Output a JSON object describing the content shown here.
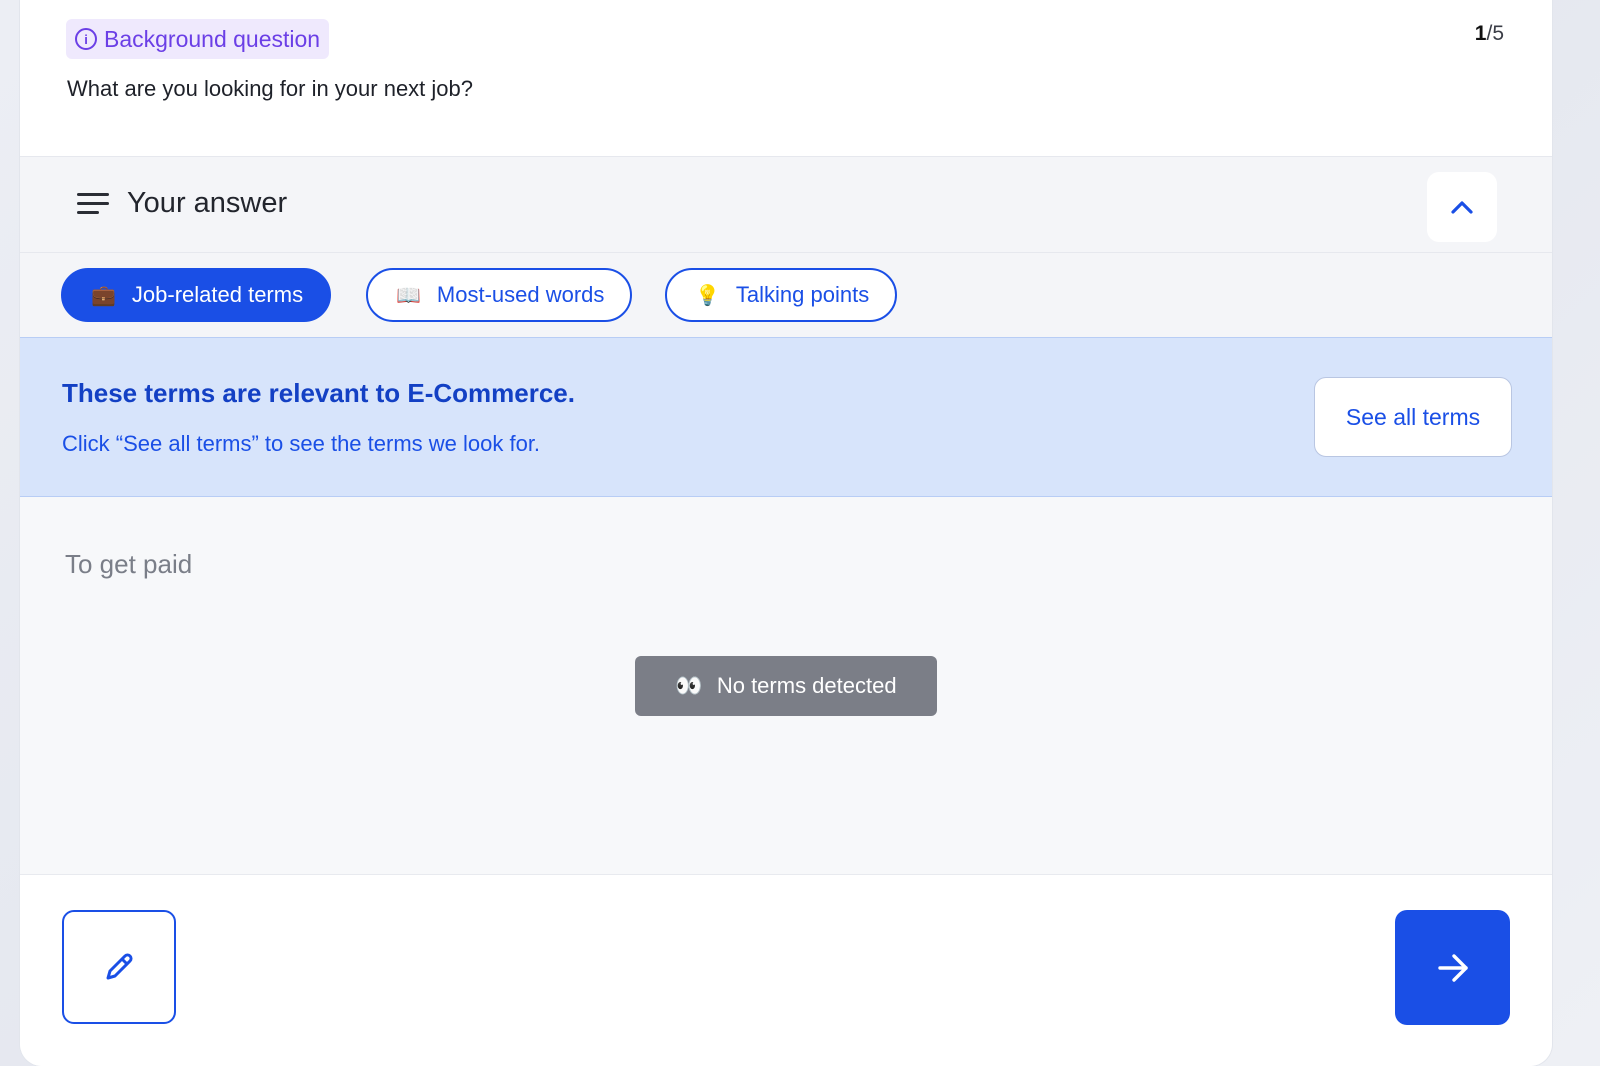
{
  "question": {
    "tag_label": "Background question",
    "text": "What are you looking for in your next job?",
    "counter_current": "1",
    "counter_sep": "/",
    "counter_total": "5"
  },
  "answer_panel": {
    "title": "Your answer"
  },
  "chips": [
    {
      "emoji": "💼",
      "label": "Job-related terms",
      "active": true
    },
    {
      "emoji": "📖",
      "label": "Most-used words",
      "active": false
    },
    {
      "emoji": "💡",
      "label": "Talking points",
      "active": false
    }
  ],
  "banner": {
    "title": "These terms are relevant to E-Commerce.",
    "subtitle": "Click “See all terms” to see the terms we look for.",
    "button_label": "See all terms"
  },
  "answer": {
    "text": "To get paid",
    "status_emoji": "👀",
    "status_label": "No terms detected"
  },
  "colors": {
    "primary": "#1a4fe6",
    "tag_purple": "#6b3fe6",
    "banner_bg": "#d7e4fb",
    "status_gray": "#7b7e87"
  },
  "icons": [
    "info-icon",
    "menu-lines-icon",
    "chevron-up-icon",
    "briefcase-icon",
    "book-icon",
    "lightbulb-icon",
    "eyes-icon",
    "pencil-icon",
    "arrow-right-icon"
  ]
}
